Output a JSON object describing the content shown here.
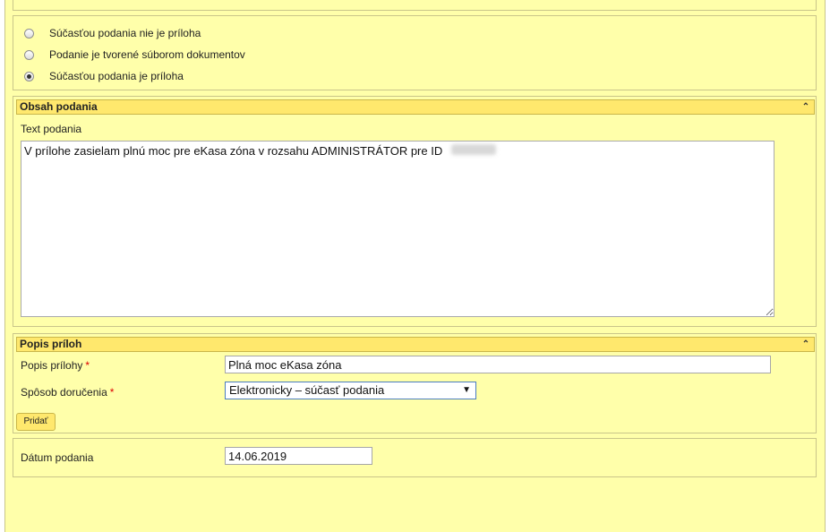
{
  "attachment_options": [
    {
      "label": "Súčasťou podania nie je príloha",
      "checked": false
    },
    {
      "label": "Podanie je tvorené súborom dokumentov",
      "checked": false
    },
    {
      "label": "Súčasťou podania je príloha",
      "checked": true
    }
  ],
  "obsah": {
    "header": "Obsah podania",
    "text_label": "Text podania",
    "text_value": "V prílohe zasielam plnú moc pre eKasa zóna v rozsahu ADMINISTRÁTOR pre ID"
  },
  "popis": {
    "header": "Popis príloh",
    "popis_label": "Popis prílohy",
    "popis_value": "Plná moc eKasa zóna",
    "sposob_label": "Spôsob doručenia",
    "sposob_value": "Elektronicky – súčasť podania",
    "required_mark": "*",
    "add_button": "Pridať"
  },
  "datum": {
    "label": "Dátum podania",
    "value": "14.06.2019"
  },
  "icons": {
    "collapse": "chevron-up-icon",
    "dropdown": "dropdown-arrow-icon"
  },
  "colors": {
    "background": "#ffffaa",
    "header": "#ffe86d",
    "required": "#dd0000"
  }
}
